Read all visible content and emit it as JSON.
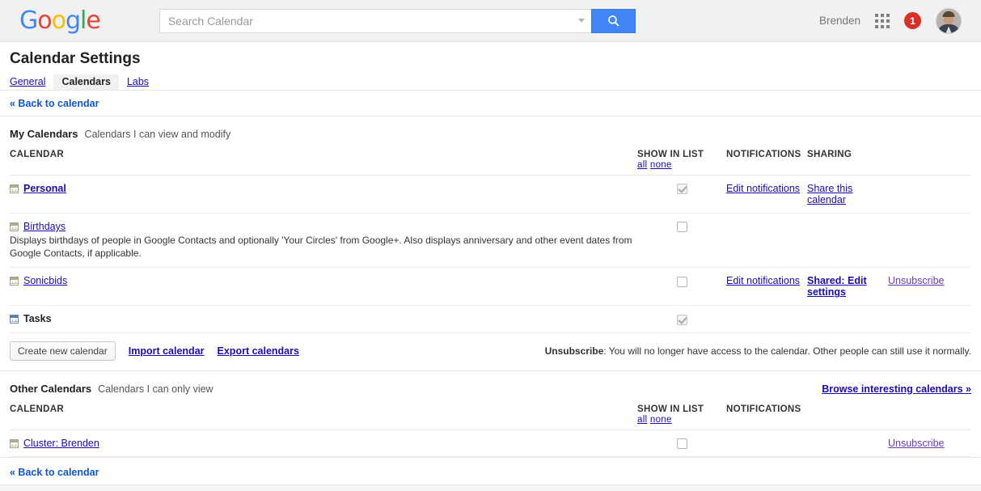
{
  "topbar": {
    "logo_letters": [
      {
        "ch": "G",
        "color": "#4285f4"
      },
      {
        "ch": "o",
        "color": "#ea4335"
      },
      {
        "ch": "o",
        "color": "#fbbc05"
      },
      {
        "ch": "g",
        "color": "#4285f4"
      },
      {
        "ch": "l",
        "color": "#34a853"
      },
      {
        "ch": "e",
        "color": "#ea4335"
      }
    ],
    "logo_text": "Google",
    "search_placeholder": "Search Calendar",
    "search_value": "",
    "search_button_icon": "search-icon",
    "dropdown_icon": "chevron-down-icon",
    "user_name": "Brenden",
    "apps_icon": "apps-grid-icon",
    "notification_count": "1",
    "avatar_icon": "user-avatar"
  },
  "page": {
    "title": "Calendar Settings",
    "tabs": [
      {
        "label": "General",
        "active": false
      },
      {
        "label": "Calendars",
        "active": true
      },
      {
        "label": "Labs",
        "active": false
      }
    ],
    "back_to_calendar": "« Back to calendar",
    "bottom_back_to_calendar": "« Back to calendar"
  },
  "my_calendars": {
    "title": "My Calendars",
    "subtitle": "Calendars I can view and modify",
    "columns": {
      "calendar": "CALENDAR",
      "show_in_list": "SHOW IN LIST",
      "show_all": "all",
      "show_none": "none",
      "notifications": "NOTIFICATIONS",
      "sharing": "SHARING"
    },
    "rows": [
      {
        "name": "Personal",
        "name_style": "bold-link",
        "icon": "calendar-icon",
        "icon_color": "tan",
        "description": "",
        "checked": true,
        "checkbox_disabled": true,
        "notifications_link": "Edit notifications",
        "sharing_link": "Share this calendar",
        "sharing_bold": false,
        "unsubscribe_link": ""
      },
      {
        "name": "Birthdays",
        "name_style": "link",
        "icon": "calendar-icon",
        "icon_color": "tan",
        "description": "Displays birthdays of people in Google Contacts and optionally 'Your Circles' from Google+. Also displays anniversary and other event dates from Google Contacts, if applicable.",
        "checked": false,
        "checkbox_disabled": false,
        "notifications_link": "",
        "sharing_link": "",
        "sharing_bold": false,
        "unsubscribe_link": ""
      },
      {
        "name": "Sonicbids",
        "name_style": "link",
        "icon": "calendar-icon",
        "icon_color": "tan",
        "description": "",
        "checked": false,
        "checkbox_disabled": false,
        "notifications_link": "Edit notifications",
        "sharing_link": "Shared: Edit settings",
        "sharing_bold": true,
        "unsubscribe_link": "Unsubscribe"
      },
      {
        "name": "Tasks",
        "name_style": "plain-bold",
        "icon": "calendar-icon",
        "icon_color": "blue",
        "description": "",
        "checked": true,
        "checkbox_disabled": true,
        "notifications_link": "",
        "sharing_link": "",
        "sharing_bold": false,
        "unsubscribe_link": ""
      }
    ],
    "actions": {
      "create_button": "Create new calendar",
      "import_link": "Import calendar",
      "export_link": "Export calendars",
      "unsubscribe_note_label": "Unsubscribe",
      "unsubscribe_note_text": ": You will no longer have access to the calendar. Other people can still use it normally."
    }
  },
  "other_calendars": {
    "title": "Other Calendars",
    "subtitle": "Calendars I can only view",
    "browse_link": "Browse interesting calendars »",
    "columns": {
      "calendar": "CALENDAR",
      "show_in_list": "SHOW IN LIST",
      "show_all": "all",
      "show_none": "none",
      "notifications": "NOTIFICATIONS"
    },
    "rows": [
      {
        "name": "Cluster: Brenden",
        "name_style": "link",
        "icon": "calendar-icon",
        "icon_color": "tan",
        "checked": false,
        "checkbox_disabled": false,
        "notifications_link": "",
        "unsubscribe_link": "Unsubscribe"
      }
    ]
  },
  "colors": {
    "link_blue": "#1a0dab",
    "visited_purple": "#6a3ab2",
    "google_blue": "#4285f4",
    "notification_red": "#d93025",
    "topbar_bg": "#f1f1f1"
  }
}
